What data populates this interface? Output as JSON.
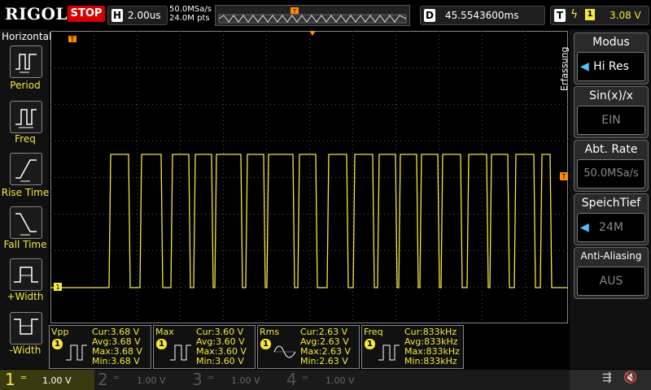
{
  "topbar": {
    "logo": "RIGOL",
    "run_state": "STOP",
    "timebase_letter": "H",
    "timebase": "2.00us",
    "sample_rate": "50.0MSa/s",
    "memory_points": "24.0M pts",
    "trigger_marker": "T",
    "delay_letter": "D",
    "delay": "45.5543600ms",
    "trigger_letter": "T",
    "trigger_slope": "ϟ",
    "trigger_channel": "1",
    "trigger_level": "3.08 V"
  },
  "left_panel": {
    "title": "Horizontal",
    "items": [
      {
        "label": "Period",
        "icon": "period-icon"
      },
      {
        "label": "Freq",
        "icon": "freq-icon"
      },
      {
        "label": "Rise Time",
        "icon": "rise-time-icon"
      },
      {
        "label": "Fall Time",
        "icon": "fall-time-icon"
      },
      {
        "label": "+Width",
        "icon": "pos-width-icon"
      },
      {
        "label": "-Width",
        "icon": "neg-width-icon"
      }
    ]
  },
  "right_panel": {
    "section_label": "Erfassung",
    "groups": [
      {
        "title": "Modus",
        "value": "Hi Res",
        "active": true
      },
      {
        "title": "Sin(x)/x",
        "value": "EIN",
        "active": false
      },
      {
        "title": "Abt. Rate",
        "value": "50.0MSa/s",
        "active": false
      },
      {
        "title": "SpeichTief",
        "value": "24M",
        "active": true
      },
      {
        "title": "Anti-Aliasing",
        "value": "AUS",
        "active": false
      }
    ]
  },
  "markers": {
    "trigger_top": "T",
    "trigger_right": "T",
    "channel_ground": "1"
  },
  "measurements": [
    {
      "name": "Vpp",
      "channel": "1",
      "cur": "Cur:3.68 V",
      "avg": "Avg:3.68 V",
      "max": "Max:3.68 V",
      "min": "Min:3.68 V"
    },
    {
      "name": "Max",
      "channel": "1",
      "cur": "Cur:3.60 V",
      "avg": "Avg:3.60 V",
      "max": "Max:3.60 V",
      "min": "Min:3.60 V"
    },
    {
      "name": "Rms",
      "channel": "1",
      "cur": "Cur:2.63 V",
      "avg": "Avg:2.63 V",
      "max": "Max:2.63 V",
      "min": "Min:2.63 V"
    },
    {
      "name": "Freq",
      "channel": "1",
      "cur": "Cur:833kHz",
      "avg": "Avg:833kHz",
      "max": "Max:833kHz",
      "min": "Min:833kHz"
    }
  ],
  "channels": [
    {
      "num": "1",
      "scale": "1.00 V",
      "color": "#f5e642",
      "active": true
    },
    {
      "num": "2",
      "scale": "1.00 V",
      "color": "#00c8ff",
      "active": false
    },
    {
      "num": "3",
      "scale": "1.00 V",
      "color": "#ff40ff",
      "active": false
    },
    {
      "num": "4",
      "scale": "1.00 V",
      "color": "#3080ff",
      "active": false
    }
  ],
  "colors": {
    "trace": "#f5e642",
    "grid": "#505050",
    "stop": "#d40000",
    "marker": "#ff8c00"
  }
}
